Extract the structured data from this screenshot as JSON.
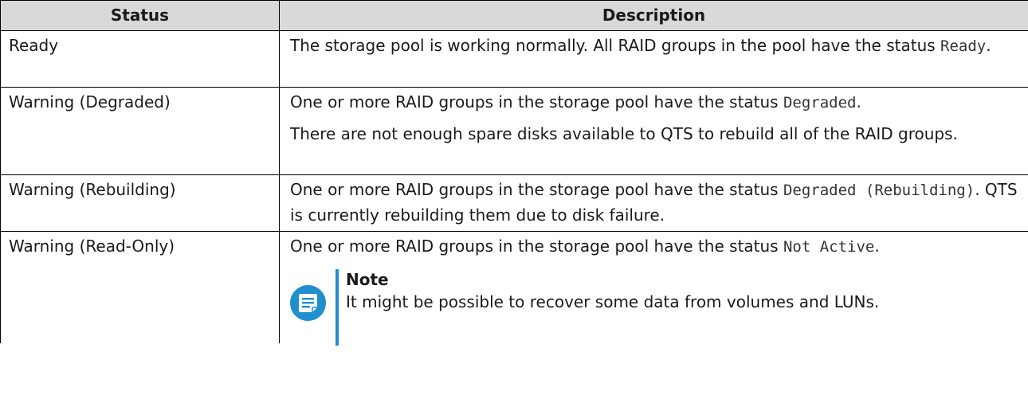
{
  "table": {
    "headers": {
      "status": "Status",
      "description": "Description"
    },
    "rows": [
      {
        "status": "Ready",
        "desc_text": "The storage pool is working normally. All RAID groups in the pool have the status ",
        "desc_code": "Ready",
        "desc_end": "."
      },
      {
        "status": "Warning (Degraded)",
        "desc_text": "One or more RAID groups in the storage pool have the status ",
        "desc_code": "Degraded",
        "desc_end": ".",
        "desc_para2": "There are not enough spare disks available to QTS to rebuild all of the RAID groups."
      },
      {
        "status": "Warning (Rebuilding)",
        "desc_text": "One or more RAID groups in the storage pool have the status ",
        "desc_code": "Degraded (Rebuilding)",
        "desc_end": ". QTS is currently rebuilding them due to disk failure."
      },
      {
        "status": "Warning (Read-Only)",
        "desc_text": "One or more RAID groups in the storage pool have the status ",
        "desc_code": "Not Active",
        "desc_end": ".",
        "note": {
          "icon": "note-icon",
          "title": "Note",
          "text": "It might be possible to recover some data from volumes and LUNs."
        }
      }
    ]
  },
  "colors": {
    "header_bg": "#d9d9d9",
    "note_accent": "#1f8fcf"
  }
}
